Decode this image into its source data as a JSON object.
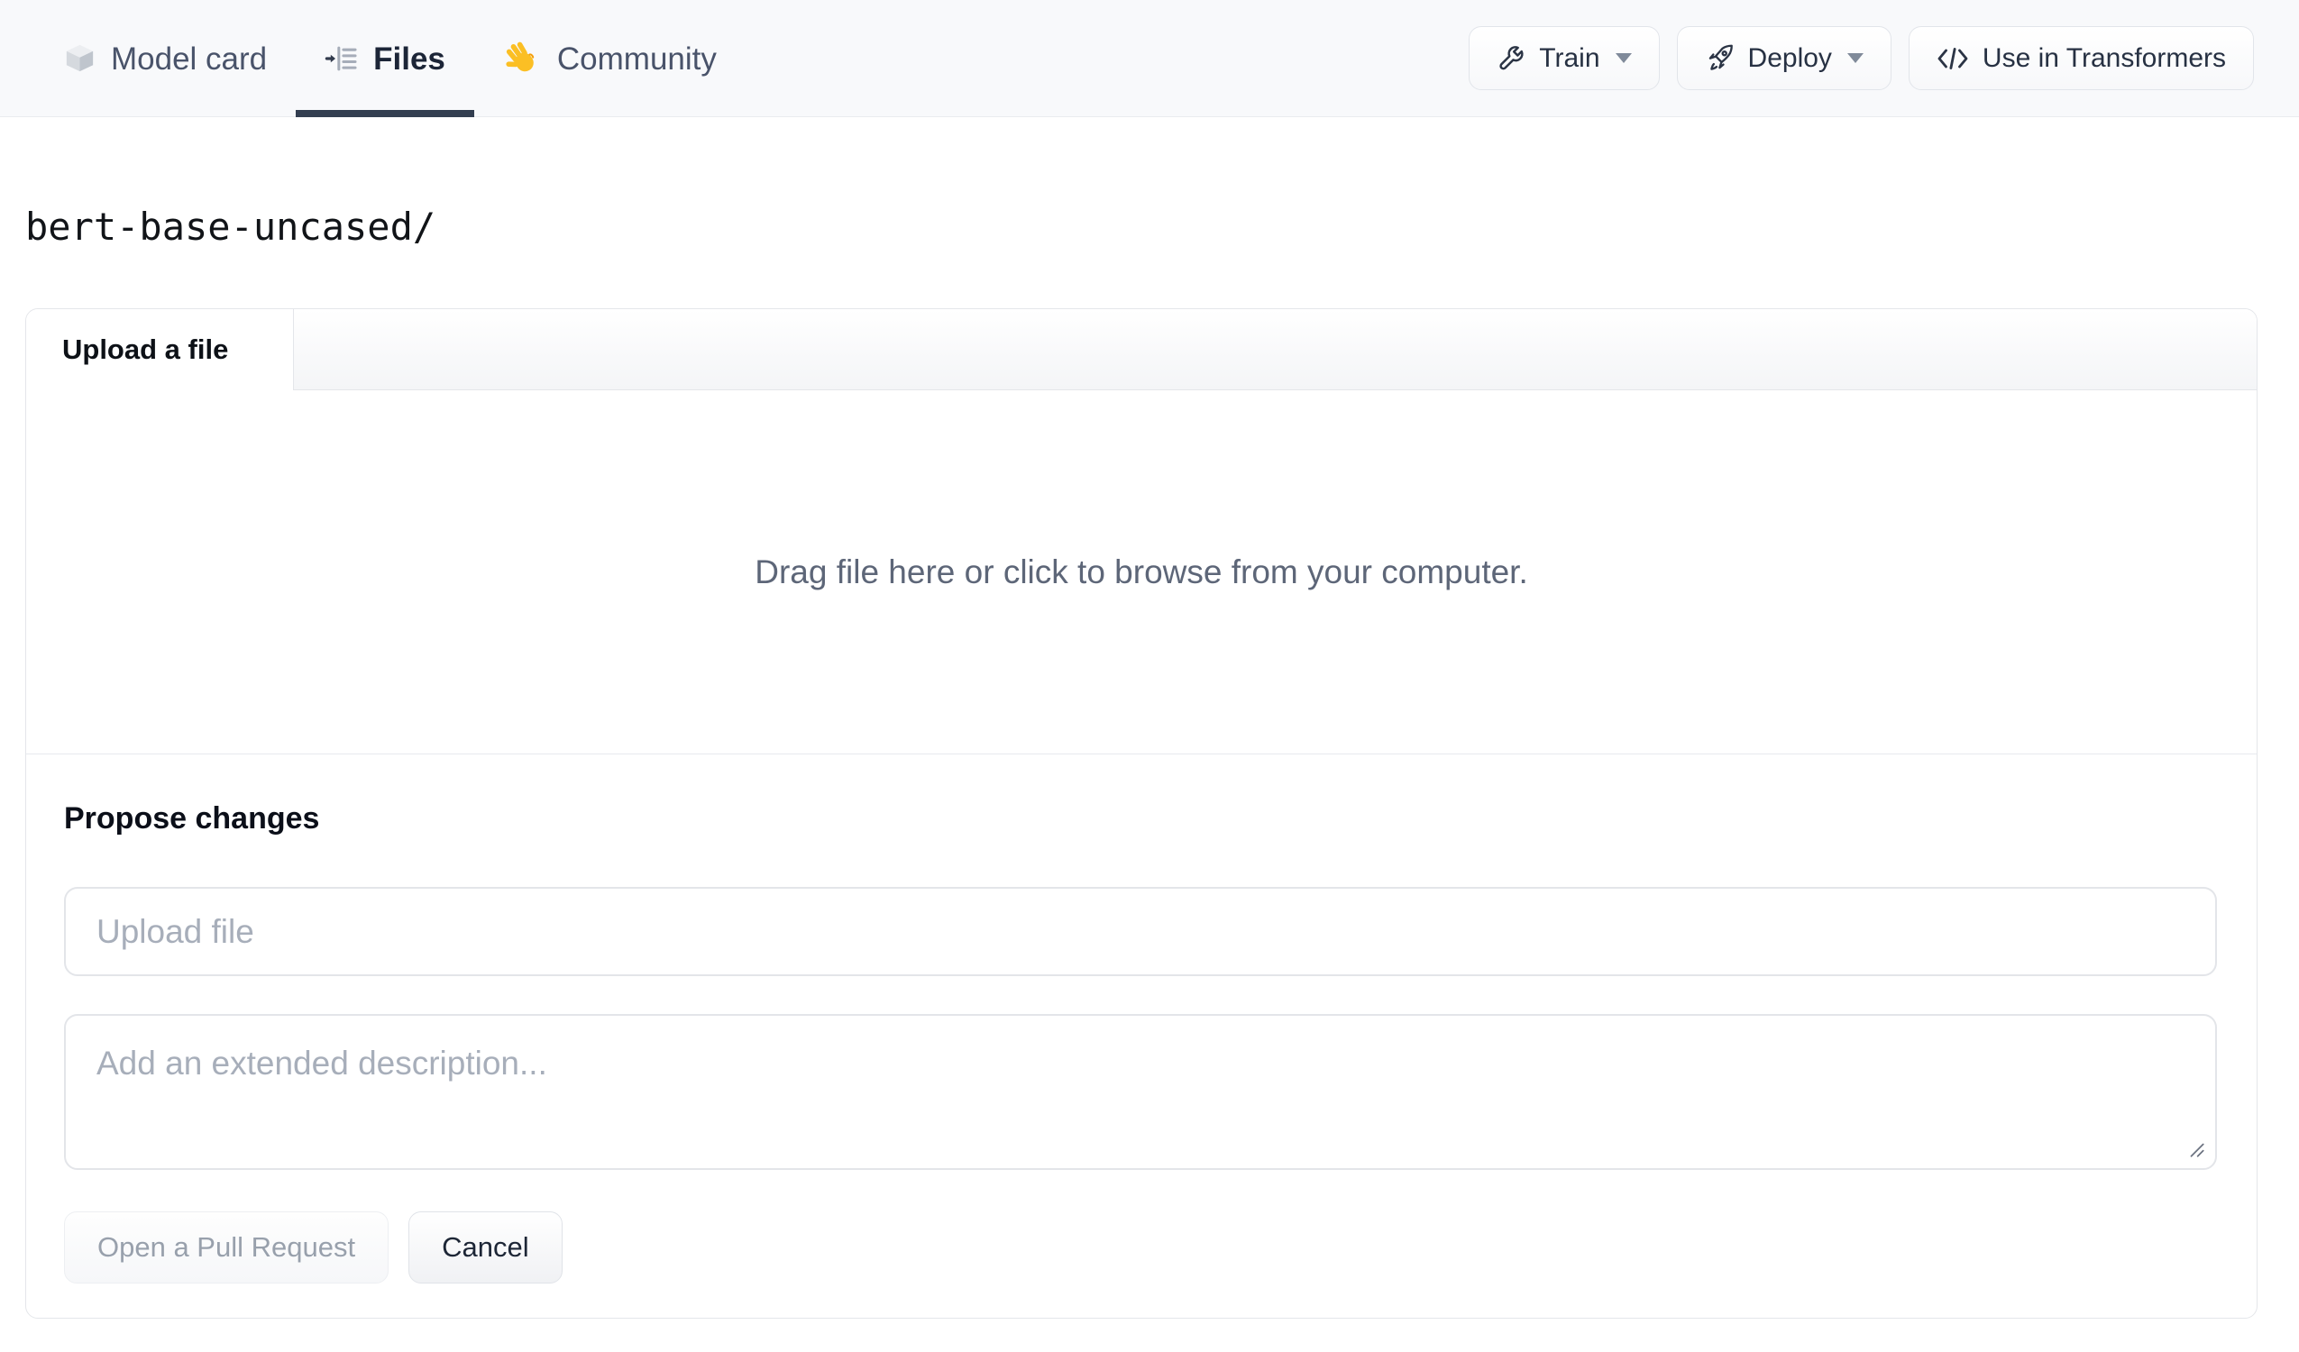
{
  "header": {
    "tabs": [
      {
        "label": "Model card",
        "icon": "cube-icon",
        "active": false
      },
      {
        "label": "Files",
        "icon": "files-list-icon",
        "active": true
      },
      {
        "label": "Community",
        "icon": "waving-hand-icon",
        "active": false
      }
    ],
    "actions": [
      {
        "label": "Train",
        "icon": "wrench-icon",
        "has_caret": true
      },
      {
        "label": "Deploy",
        "icon": "rocket-icon",
        "has_caret": true
      },
      {
        "label": "Use in Transformers",
        "icon": "code-icon",
        "has_caret": false
      }
    ]
  },
  "breadcrumb": {
    "path": "bert-base-uncased/"
  },
  "upload_panel": {
    "tab_label": "Upload a file",
    "dropzone_text": "Drag file here or click to browse from your computer.",
    "propose": {
      "heading": "Propose changes",
      "filename_placeholder": "Upload file",
      "description_placeholder": "Add an extended description...",
      "open_pr_label": "Open a Pull Request",
      "cancel_label": "Cancel"
    }
  },
  "colors": {
    "header_background": "#f8f9fb",
    "active_tab_underline": "#333e50",
    "panel_border": "#e4e6ea",
    "hand_icon_yellow": "#fbbf24",
    "muted_text": "#5d6678",
    "placeholder_text": "#a7aeba"
  }
}
